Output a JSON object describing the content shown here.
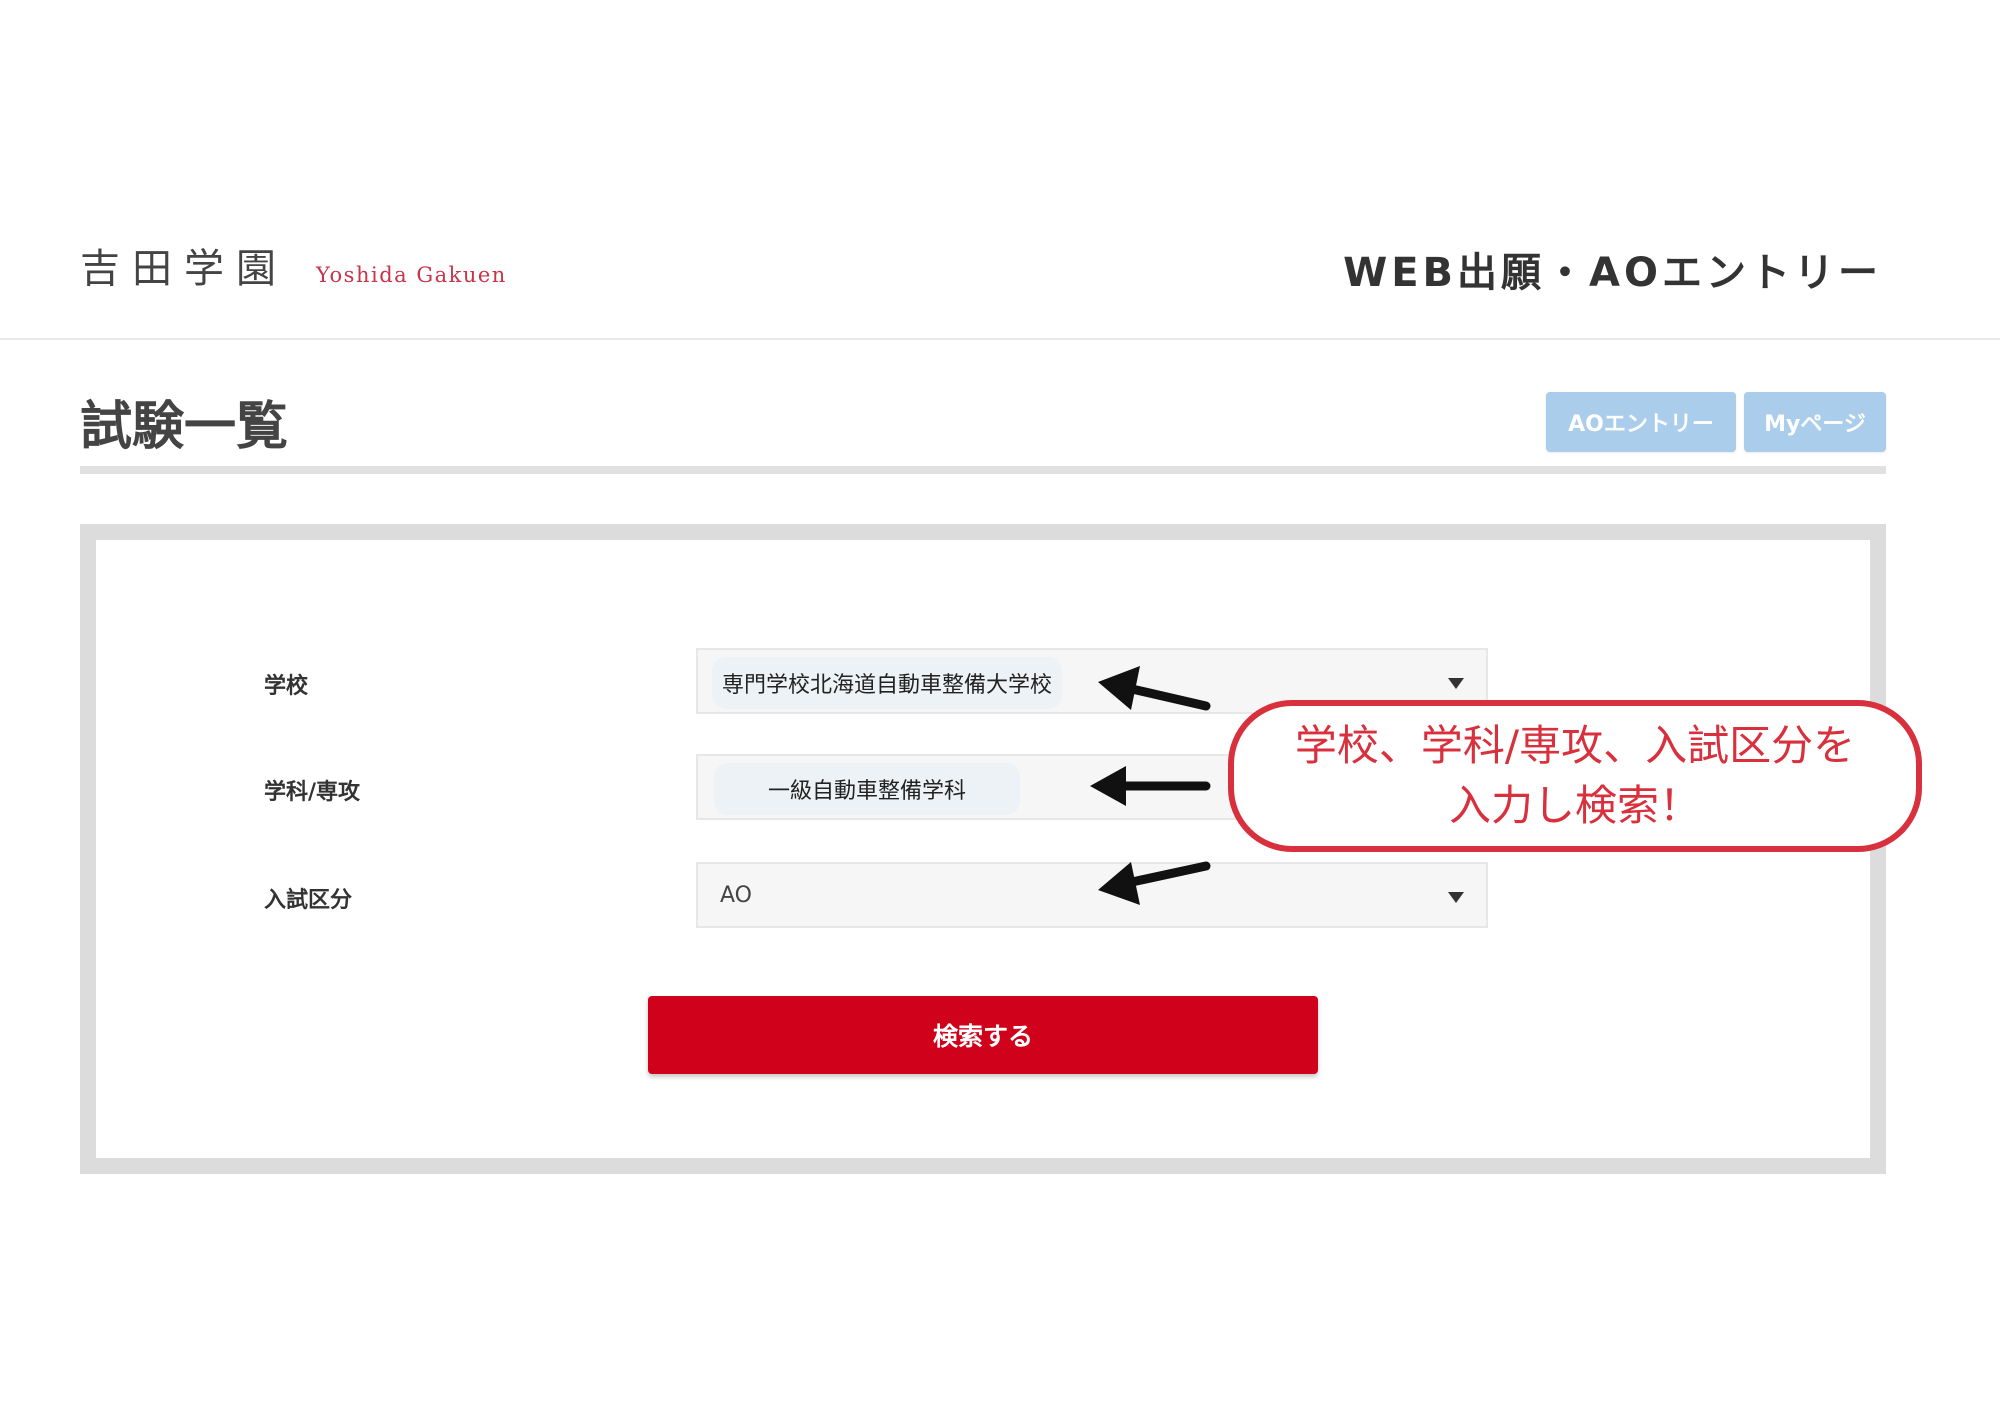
{
  "header": {
    "logo_ja": "吉田学園",
    "logo_en": "Yoshida Gakuen",
    "site_title": "WEB出願・AOエントリー"
  },
  "page": {
    "title": "試験一覧"
  },
  "nav": {
    "ao_entry_label": "AOエントリー",
    "mypage_label": "Myページ"
  },
  "form": {
    "school": {
      "label": "学校",
      "value": "専門学校北海道自動車整備大学校"
    },
    "department": {
      "label": "学科/専攻",
      "value": "一級自動車整備学科"
    },
    "exam_type": {
      "label": "入試区分",
      "value": "AO"
    },
    "search_label": "検索する"
  },
  "annotation": {
    "line1": "学校、学科/専攻、入試区分を",
    "line2": "入力し検索！"
  },
  "colors": {
    "brand_red": "#d0021b",
    "nav_button_blue": "#a9cdea",
    "annotation_red": "#d8303c",
    "logo_en_red": "#c8344a"
  },
  "icons": {
    "select_caret": "triangle-down",
    "annotation_arrow": "arrow-left"
  }
}
